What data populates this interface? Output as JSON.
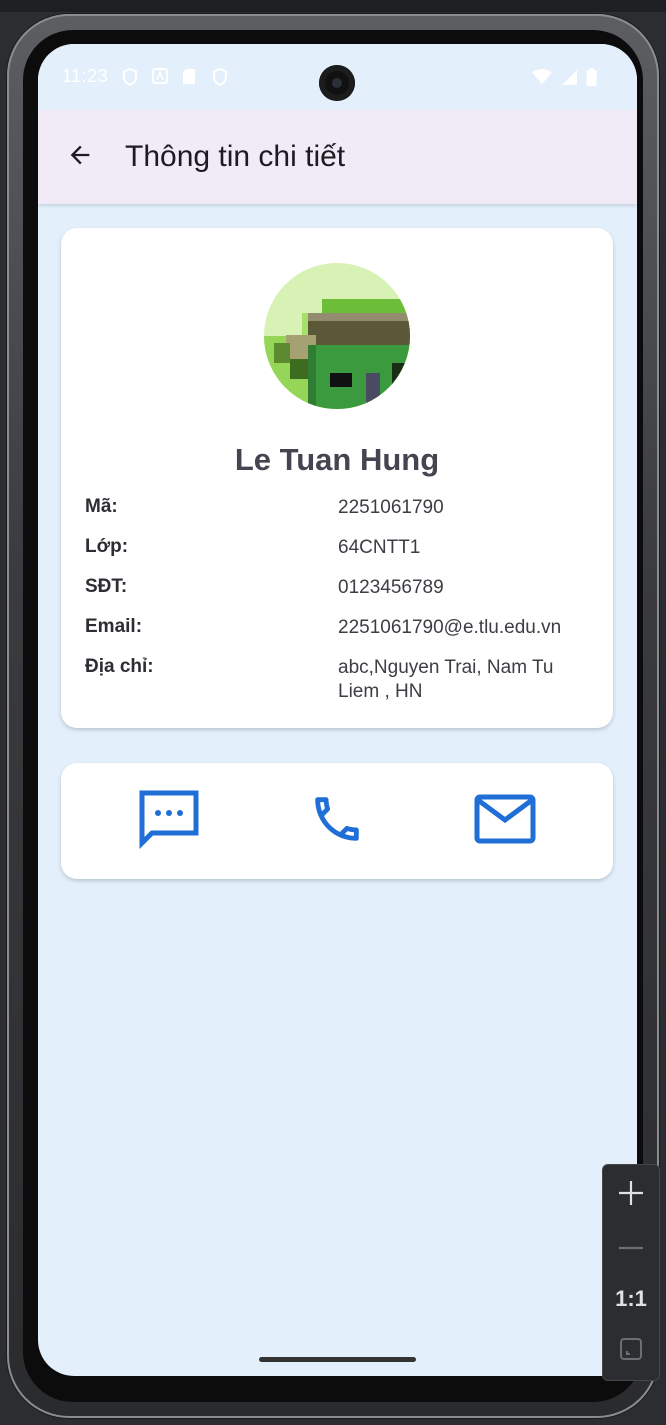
{
  "status_bar": {
    "time": "11:23"
  },
  "app_bar": {
    "title": "Thông tin chi tiết",
    "back_icon": "arrow-back-icon"
  },
  "profile": {
    "name": "Le Tuan Hung",
    "fields": [
      {
        "label": "Mã:",
        "value": "2251061790"
      },
      {
        "label": "Lớp:",
        "value": "64CNTT1"
      },
      {
        "label": "SĐT:",
        "value": "0123456789"
      },
      {
        "label": "Email:",
        "value": "2251061790@e.tlu.edu.vn"
      },
      {
        "label": "Địa chỉ:",
        "value": "abc,Nguyen Trai, Nam Tu Liem , HN"
      }
    ]
  },
  "actions": {
    "message_icon": "message-icon",
    "call_icon": "phone-icon",
    "email_icon": "email-icon"
  },
  "emulator_controls": {
    "zoom_in": "+",
    "zoom_reset_label": "1:1"
  },
  "colors": {
    "accent": "#1f6fd6",
    "screen_bg": "#e3f0fb",
    "app_bar_bg": "#f1ebf7"
  }
}
